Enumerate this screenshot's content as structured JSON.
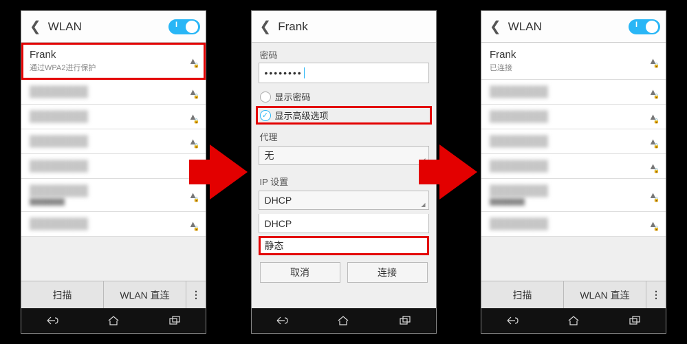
{
  "screen1": {
    "title": "WLAN",
    "toggle": true,
    "network": {
      "name": "Frank",
      "sub": "通过WPA2进行保护"
    },
    "btn_scan": "扫描",
    "btn_direct": "WLAN 直连"
  },
  "screen2": {
    "title": "Frank",
    "pwd_label": "密码",
    "pwd_value": "••••••••",
    "show_pwd": "显示密码",
    "show_adv": "显示高级选项",
    "proxy_label": "代理",
    "proxy_value": "无",
    "ip_label": "IP 设置",
    "ip_value": "DHCP",
    "ip_options": {
      "dhcp": "DHCP",
      "static": "静态"
    },
    "cancel": "取消",
    "connect": "连接"
  },
  "screen3": {
    "title": "WLAN",
    "toggle": true,
    "network": {
      "name": "Frank",
      "sub": "已连接"
    },
    "btn_scan": "扫描",
    "btn_direct": "WLAN 直连"
  },
  "blur_placeholder": "████████"
}
